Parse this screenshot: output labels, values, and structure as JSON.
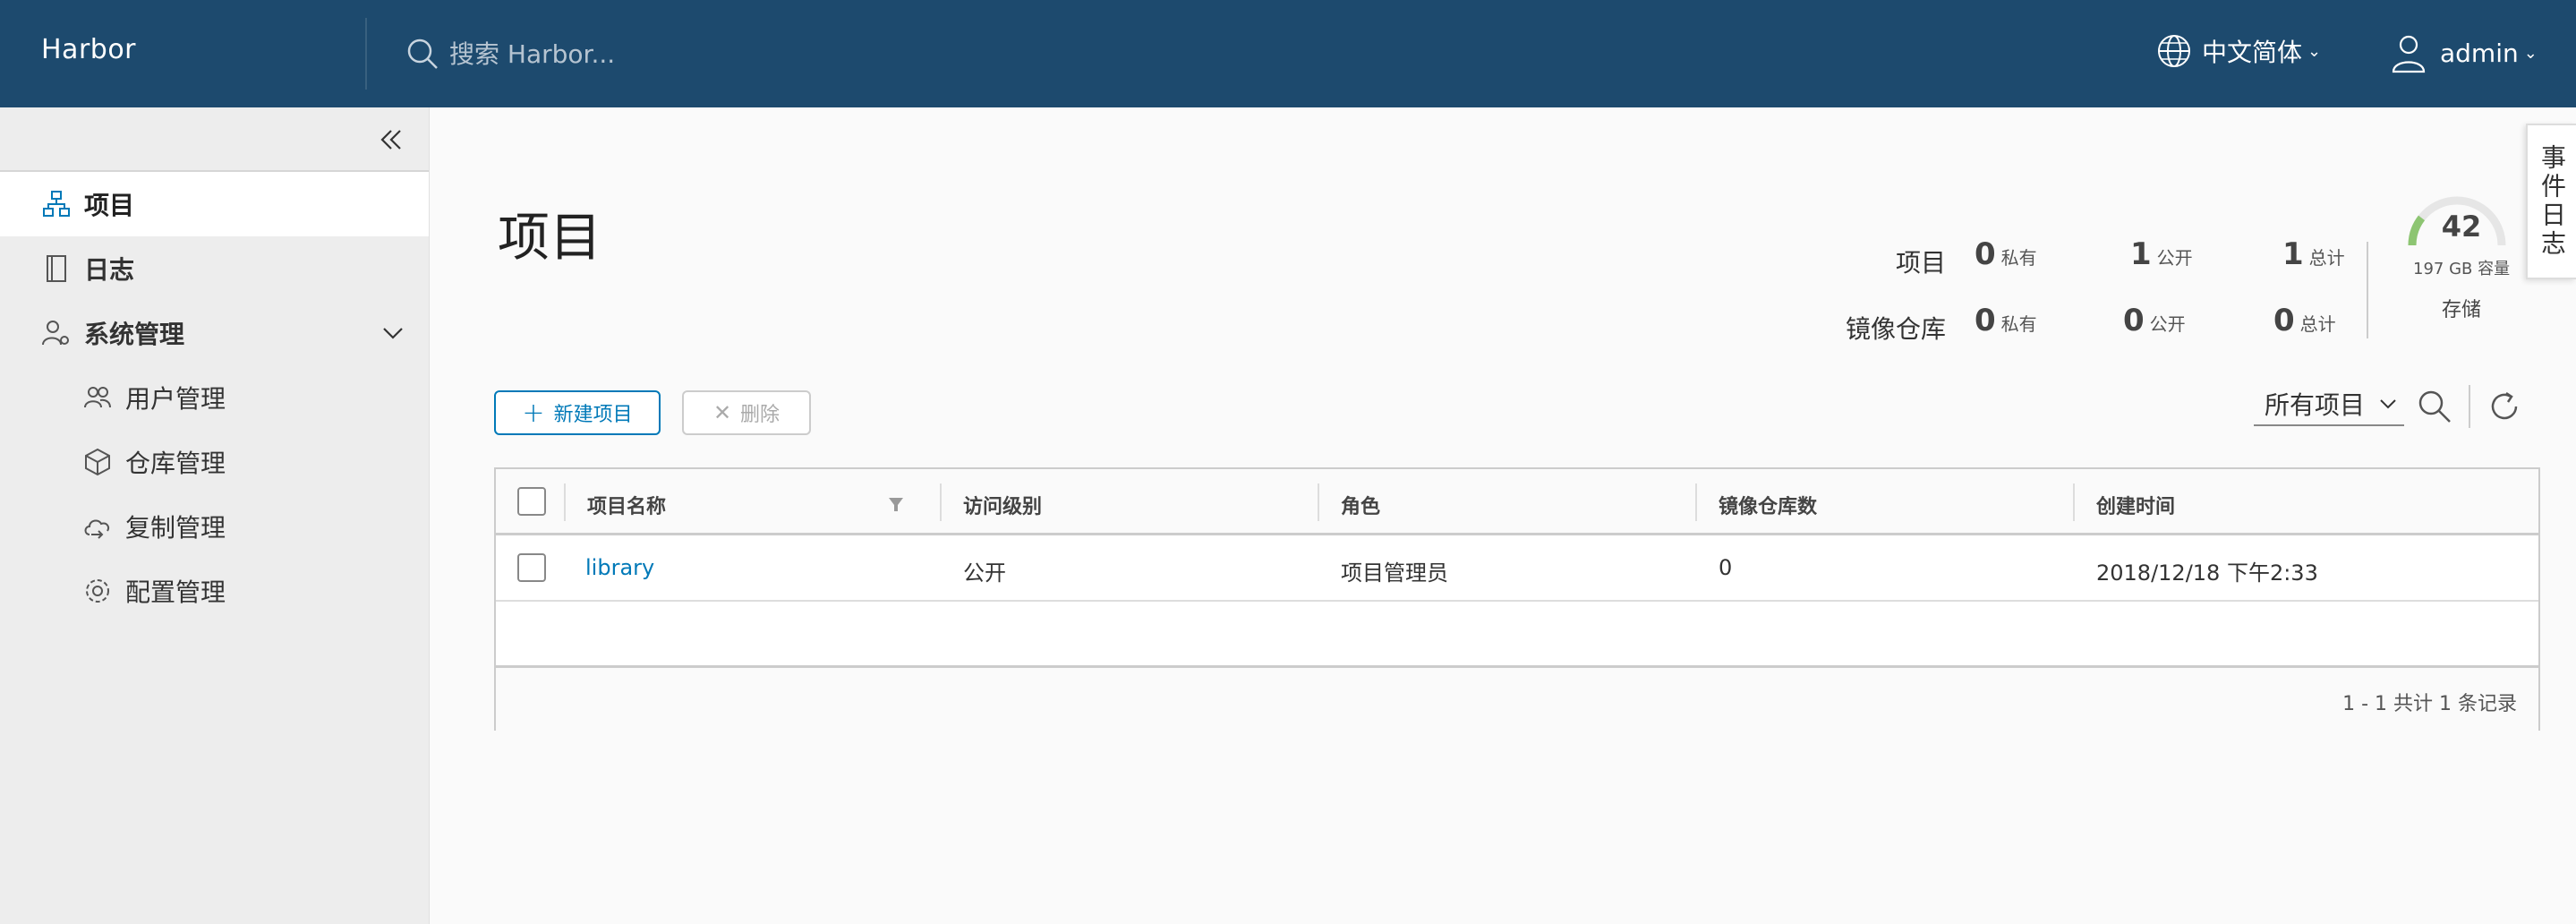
{
  "header": {
    "brand": "Harbor",
    "search_placeholder": "搜索 Harbor...",
    "language": "中文简体",
    "user": "admin"
  },
  "sidebar": {
    "items": [
      {
        "label": "项目",
        "icon": "project-icon"
      },
      {
        "label": "日志",
        "icon": "log-icon"
      },
      {
        "label": "系统管理",
        "icon": "admin-icon"
      },
      {
        "label": "用户管理",
        "icon": "users-icon"
      },
      {
        "label": "仓库管理",
        "icon": "registry-icon"
      },
      {
        "label": "复制管理",
        "icon": "replication-icon"
      },
      {
        "label": "配置管理",
        "icon": "gear-icon"
      }
    ]
  },
  "main": {
    "title": "项目",
    "summary": {
      "projects": {
        "label": "项目",
        "private": "0",
        "public": "1",
        "total": "1"
      },
      "repos": {
        "label": "镜像仓库",
        "private": "0",
        "public": "0",
        "total": "0"
      },
      "units": {
        "private": "私有",
        "public": "公开",
        "total": "总计"
      }
    },
    "storage": {
      "value": "42",
      "capacity": "197 GB 容量",
      "label": "存储",
      "used_fraction": 0.21
    },
    "event_log": "事件日志",
    "toolbar": {
      "new_label": "新建项目",
      "delete_label": "删除",
      "filter_value": "所有项目"
    },
    "table": {
      "columns": [
        "项目名称",
        "访问级别",
        "角色",
        "镜像仓库数",
        "创建时间"
      ],
      "rows": [
        {
          "name": "library",
          "access": "公开",
          "role": "项目管理员",
          "repo_count": "0",
          "created": "2018/12/18 下午2:33"
        }
      ],
      "footer": "1 - 1 共计 1 条记录"
    }
  }
}
